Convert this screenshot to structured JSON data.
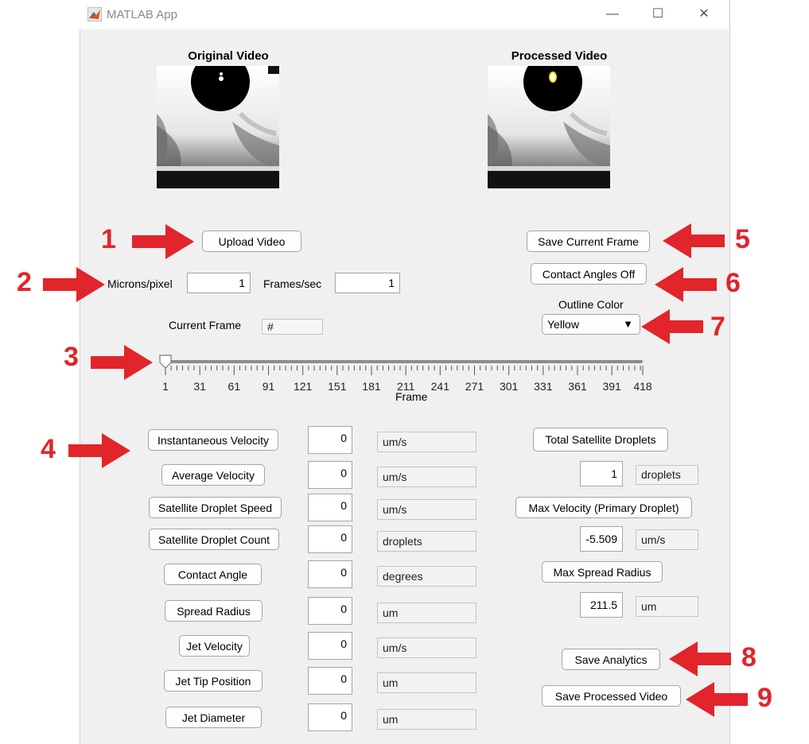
{
  "window": {
    "title": "MATLAB App",
    "minimize_glyph": "—",
    "maximize_glyph": "☐",
    "close_glyph": "✕"
  },
  "videos": {
    "original_title": "Original Video",
    "processed_title": "Processed Video"
  },
  "controls": {
    "upload_video": "Upload Video",
    "save_current_frame": "Save Current Frame",
    "contact_angles": "Contact Angles Off",
    "microns_label": "Microns/pixel",
    "microns_value": "1",
    "fps_label": "Frames/sec",
    "fps_value": "1",
    "current_frame_label": "Current Frame",
    "current_frame_value": "#",
    "outline_color_label": "Outline Color",
    "outline_color_value": "Yellow"
  },
  "slider": {
    "value": 1,
    "min": 1,
    "max": 418,
    "tick_labels": [
      "1",
      "31",
      "61",
      "91",
      "121",
      "151",
      "181",
      "211",
      "241",
      "271",
      "301",
      "331",
      "361",
      "391",
      "418"
    ],
    "axis_label": "Frame"
  },
  "metrics": [
    {
      "label": "Instantaneous Velocity",
      "value": "0",
      "unit": "um/s"
    },
    {
      "label": "Average Velocity",
      "value": "0",
      "unit": "um/s"
    },
    {
      "label": "Satellite Droplet Speed",
      "value": "0",
      "unit": "um/s"
    },
    {
      "label": "Satellite Droplet Count",
      "value": "0",
      "unit": "droplets"
    },
    {
      "label": "Contact Angle",
      "value": "0",
      "unit": "degrees"
    },
    {
      "label": "Spread Radius",
      "value": "0",
      "unit": "um"
    },
    {
      "label": "Jet Velocity",
      "value": "0",
      "unit": "um/s"
    },
    {
      "label": "Jet Tip Position",
      "value": "0",
      "unit": "um"
    },
    {
      "label": "Jet Diameter",
      "value": "0",
      "unit": "um"
    }
  ],
  "right_metrics": [
    {
      "label": "Total Satellite Droplets",
      "value": "1",
      "unit": "droplets"
    },
    {
      "label": "Max Velocity (Primary Droplet)",
      "value": "-5.509",
      "unit": "um/s"
    },
    {
      "label": "Max Spread Radius",
      "value": "211.5",
      "unit": "um"
    }
  ],
  "actions": {
    "save_analytics": "Save Analytics",
    "save_processed_video": "Save Processed Video"
  },
  "annotations": [
    "1",
    "2",
    "3",
    "4",
    "5",
    "6",
    "7",
    "8",
    "9"
  ],
  "colors": {
    "annotation_red": "#e2242b",
    "window_bg": "#f0f0f0",
    "outline": "#f5e400"
  },
  "icons": {
    "app": "matlab-icon",
    "dropdown": "triangle-down-icon"
  }
}
